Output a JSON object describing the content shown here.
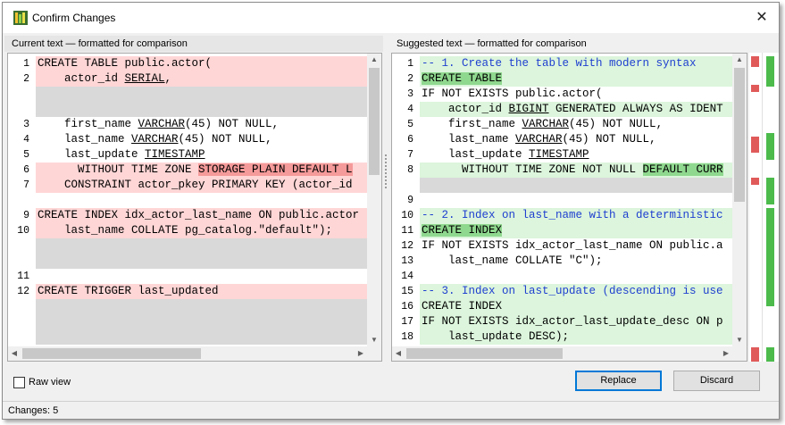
{
  "window": {
    "title": "Confirm Changes",
    "close_glyph": "✕"
  },
  "left_pane": {
    "header": "Current text — formatted for comparison",
    "lines": [
      {
        "num": "1",
        "type": "del",
        "segs": [
          {
            "t": "CREATE TABLE public.actor(",
            "c": ""
          }
        ]
      },
      {
        "num": "2",
        "type": "del",
        "segs": [
          {
            "t": "    actor_id ",
            "c": ""
          },
          {
            "t": "SERIAL",
            "c": "ul"
          },
          {
            "t": ",",
            "c": ""
          }
        ]
      },
      {
        "num": "",
        "type": "gap",
        "segs": []
      },
      {
        "num": "",
        "type": "gap",
        "segs": []
      },
      {
        "num": "3",
        "type": "",
        "segs": [
          {
            "t": "    first_name ",
            "c": ""
          },
          {
            "t": "VARCHAR",
            "c": "ul"
          },
          {
            "t": "(45) NOT NULL,",
            "c": ""
          }
        ]
      },
      {
        "num": "4",
        "type": "",
        "segs": [
          {
            "t": "    last_name ",
            "c": ""
          },
          {
            "t": "VARCHAR",
            "c": "ul"
          },
          {
            "t": "(45) NOT NULL,",
            "c": ""
          }
        ]
      },
      {
        "num": "5",
        "type": "",
        "segs": [
          {
            "t": "    last_update ",
            "c": ""
          },
          {
            "t": "TIMESTAMP",
            "c": "ul"
          }
        ]
      },
      {
        "num": "6",
        "type": "del",
        "segs": [
          {
            "t": "      WITHOUT TIME ZONE ",
            "c": ""
          },
          {
            "t": "STORAGE PLAIN DEFAULT L",
            "c": "seg-del"
          }
        ]
      },
      {
        "num": "7",
        "type": "del",
        "segs": [
          {
            "t": "    CONSTRAINT actor_pkey PRIMARY KEY (actor_id",
            "c": ""
          }
        ]
      },
      {
        "num": "",
        "type": "",
        "segs": []
      },
      {
        "num": "9",
        "type": "del",
        "segs": [
          {
            "t": "CREATE INDEX idx_actor_last_name ON public.actor",
            "c": ""
          }
        ]
      },
      {
        "num": "10",
        "type": "del",
        "segs": [
          {
            "t": "    last_name COLLATE pg_catalog.\"default\");",
            "c": ""
          }
        ]
      },
      {
        "num": "",
        "type": "gap",
        "segs": []
      },
      {
        "num": "",
        "type": "gap",
        "segs": []
      },
      {
        "num": "11",
        "type": "",
        "segs": []
      },
      {
        "num": "12",
        "type": "del",
        "segs": [
          {
            "t": "CREATE TRIGGER last_updated",
            "c": ""
          }
        ]
      },
      {
        "num": "",
        "type": "gap",
        "segs": []
      },
      {
        "num": "",
        "type": "gap",
        "segs": []
      },
      {
        "num": "",
        "type": "gap",
        "segs": []
      }
    ]
  },
  "right_pane": {
    "header": "Suggested text — formatted for comparison",
    "lines": [
      {
        "num": "1",
        "type": "ins",
        "segs": [
          {
            "t": "-- 1. Create the table with modern syntax",
            "c": "cmt"
          }
        ]
      },
      {
        "num": "2",
        "type": "ins",
        "segs": [
          {
            "t": "CREATE TABLE",
            "c": "seg-ins"
          }
        ]
      },
      {
        "num": "3",
        "type": "",
        "segs": [
          {
            "t": "IF NOT EXISTS public.actor(",
            "c": ""
          }
        ]
      },
      {
        "num": "4",
        "type": "ins",
        "segs": [
          {
            "t": "    actor_id ",
            "c": ""
          },
          {
            "t": "BIGINT",
            "c": "ul"
          },
          {
            "t": " GENERATED ALWAYS AS IDENT",
            "c": ""
          }
        ]
      },
      {
        "num": "5",
        "type": "",
        "segs": [
          {
            "t": "    first_name ",
            "c": ""
          },
          {
            "t": "VARCHAR",
            "c": "ul"
          },
          {
            "t": "(45) NOT NULL,",
            "c": ""
          }
        ]
      },
      {
        "num": "6",
        "type": "",
        "segs": [
          {
            "t": "    last_name ",
            "c": ""
          },
          {
            "t": "VARCHAR",
            "c": "ul"
          },
          {
            "t": "(45) NOT NULL,",
            "c": ""
          }
        ]
      },
      {
        "num": "7",
        "type": "",
        "segs": [
          {
            "t": "    last_update ",
            "c": ""
          },
          {
            "t": "TIMESTAMP",
            "c": "ul"
          }
        ]
      },
      {
        "num": "8",
        "type": "ins",
        "segs": [
          {
            "t": "      WITHOUT TIME ZONE NOT NULL ",
            "c": ""
          },
          {
            "t": "DEFAULT CURR",
            "c": "seg-ins"
          }
        ]
      },
      {
        "num": "",
        "type": "gap",
        "segs": []
      },
      {
        "num": "9",
        "type": "",
        "segs": []
      },
      {
        "num": "10",
        "type": "ins",
        "segs": [
          {
            "t": "-- 2. Index on last_name with a deterministic",
            "c": "cmt"
          }
        ]
      },
      {
        "num": "11",
        "type": "ins",
        "segs": [
          {
            "t": "CREATE INDEX",
            "c": "seg-ins"
          }
        ]
      },
      {
        "num": "12",
        "type": "",
        "segs": [
          {
            "t": "IF NOT EXISTS idx_actor_last_name ON public.a",
            "c": ""
          }
        ]
      },
      {
        "num": "13",
        "type": "",
        "segs": [
          {
            "t": "    last_name COLLATE \"C\");",
            "c": ""
          }
        ]
      },
      {
        "num": "14",
        "type": "",
        "segs": []
      },
      {
        "num": "15",
        "type": "ins",
        "segs": [
          {
            "t": "-- 3. Index on last_update (descending is use",
            "c": "cmt"
          }
        ]
      },
      {
        "num": "16",
        "type": "ins",
        "segs": [
          {
            "t": "CREATE INDEX",
            "c": ""
          }
        ]
      },
      {
        "num": "17",
        "type": "ins",
        "segs": [
          {
            "t": "IF NOT EXISTS idx_actor_last_update_desc ON p",
            "c": ""
          }
        ]
      },
      {
        "num": "18",
        "type": "ins",
        "segs": [
          {
            "t": "    last_update DESC);",
            "c": ""
          }
        ]
      }
    ]
  },
  "raw_view": {
    "label": "Raw view",
    "checked": false
  },
  "buttons": {
    "replace": "Replace",
    "discard": "Discard"
  },
  "status": {
    "text": "Changes: 5"
  },
  "colors": {
    "del_line": "#ffd6d6",
    "del_seg": "#f59a9a",
    "ins_line": "#dcf5dc",
    "ins_seg": "#8fd88f",
    "gap": "#d9d9d9"
  }
}
